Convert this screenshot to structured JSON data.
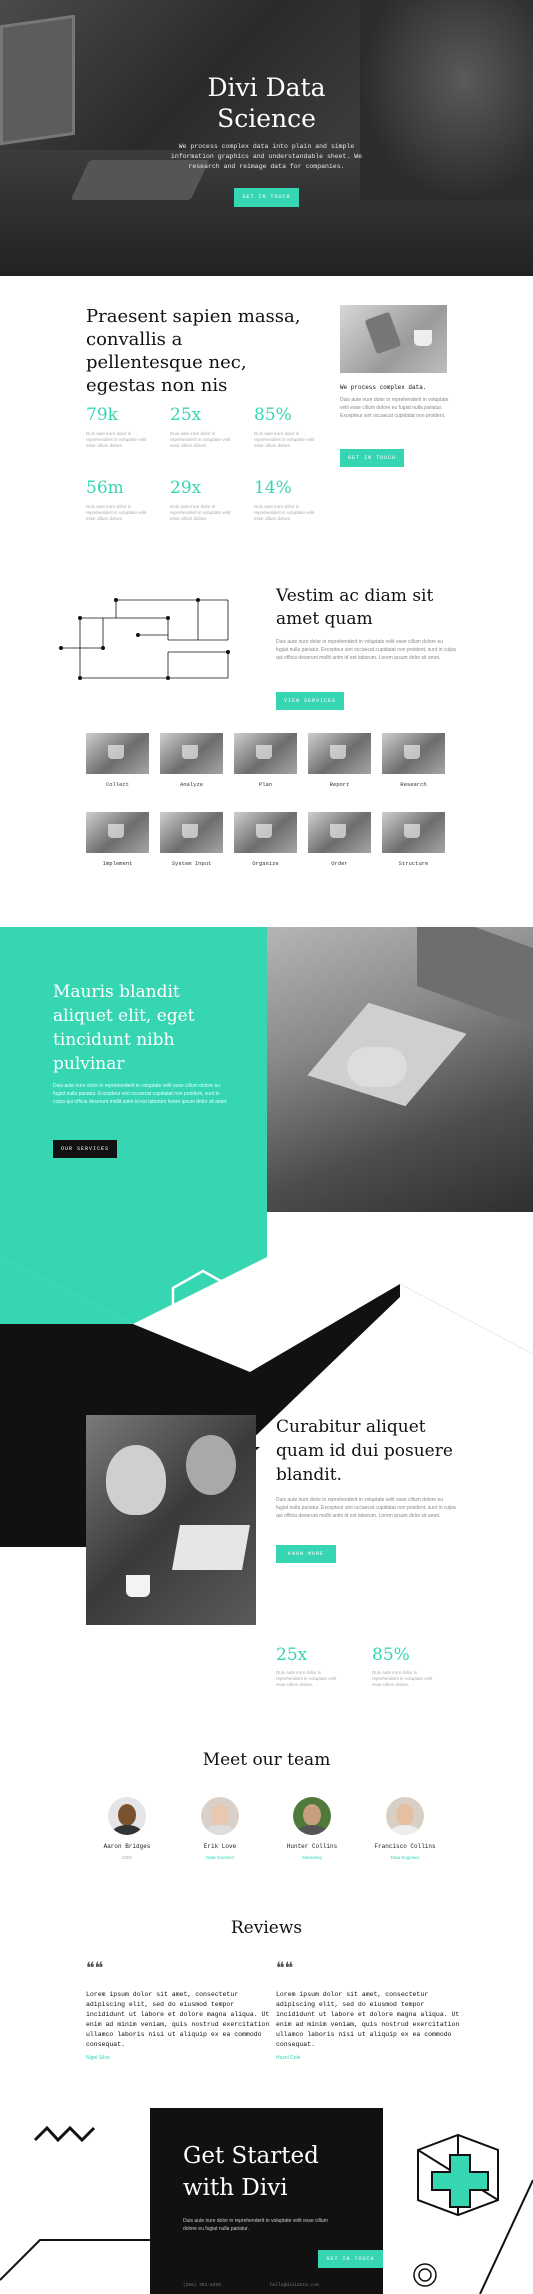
{
  "hero": {
    "title_line1": "Divi Data",
    "title_line2": "Science",
    "description": "We process complex data into plain and simple information graphics and understandable sheet. We research and reimage data for companies.",
    "button": "GET IN TOUCH"
  },
  "intro": {
    "title": "Praesent sapien massa, convallis a pellentesque nec, egestas non nis",
    "stats": [
      {
        "value": "79k",
        "text": "Duis aute irure dolor in reprehenderit in voluptate velit esse cillum dolore."
      },
      {
        "value": "25x",
        "text": "Duis aute irure dolor in reprehenderit in voluptate velit esse cillum dolore."
      },
      {
        "value": "85%",
        "text": "Duis aute irure dolor in reprehenderit in voluptate velit esse cillum dolore."
      },
      {
        "value": "56m",
        "text": "Duis aute irure dolor in reprehenderit in voluptate velit esse cillum dolore."
      },
      {
        "value": "29x",
        "text": "Duis aute irure dolor in reprehenderit in voluptate velit esse cillum dolore."
      },
      {
        "value": "14%",
        "text": "Duis aute irure dolor in reprehenderit in voluptate velit esse cillum dolore."
      }
    ],
    "subtitle": "We process complex data.",
    "body": "Duis aute irure dolor in reprehenderit in voluptate velit esse cillum dolore eu fugiat nulla pariatur. Excepteur sint occaecat cupidatat non proident.",
    "button": "GET IN TOUCH"
  },
  "process": {
    "title": "Vestim ac diam sit amet quam",
    "body": "Duis aute irure dolor in reprehenderit in voluptate velit esse cillum dolore eu fugiat nulla pariatur. Excepteur sint occaecat cupidatat non proident, sunt in culpa qui officia deserunt mollit anim id est laborum. Lorem ipsum dolor sit amet.",
    "button": "VIEW SERVICES",
    "steps_row1": [
      "Collect",
      "Analyze",
      "Plan",
      "Report",
      "Research"
    ],
    "steps_row2": [
      "Implement",
      "System Input",
      "Organize",
      "Order",
      "Structure"
    ]
  },
  "teal": {
    "title": "Mauris blandit aliquet elit, eget tincidunt nibh pulvinar",
    "body": "Duis aute irure dolor in reprehenderit in voluptate velit esse cillum dolore eu fugiat nulla pariatur. Excepteur sint occaecat cupidatat non proident, sunt in culpa qui officia deserunt mollit anim id est laborum lorem ipsum dolor sit amet.",
    "button": "OUR SERVICES"
  },
  "curabitur": {
    "title": "Curabitur aliquet quam id dui posuere blandit.",
    "body": "Duis aute irure dolor in reprehenderit in voluptate velit esse cillum dolore eu fugiat nulla pariatur. Excepteur sint occaecat cupidatat non proident, sunt in culpa qui officia deserunt mollit anim id est laborum. Lorem ipsum dolor sit amet.",
    "button": "KNOW MORE",
    "stats": [
      {
        "value": "25x",
        "text": "Duis aute irure dolor in reprehenderit in voluptate velit esse cillum dolore."
      },
      {
        "value": "85%",
        "text": "Duis aute irure dolor in reprehenderit in voluptate velit esse cillum dolore."
      }
    ]
  },
  "team": {
    "title": "Meet our team",
    "members": [
      {
        "name": "Aaron Bridges",
        "role": "CEO"
      },
      {
        "name": "Erik Love",
        "role": "Data Scientist"
      },
      {
        "name": "Hunter Collins",
        "role": "Marketing"
      },
      {
        "name": "Francisco Collins",
        "role": "Data Engineer"
      }
    ]
  },
  "reviews": {
    "title": "Reviews",
    "items": [
      {
        "text": "Lorem ipsum dolor sit amet, consectetur adipiscing elit, sed do eiusmod tempor incididunt ut labore et dolore magna aliqua. Ut enim ad minim veniam, quis nostrud exercitation ullamco laboris nisi ut aliquip ex ea commodo consequat.",
        "name": "Nigel Silva"
      },
      {
        "text": "Lorem ipsum dolor sit amet, consectetur adipiscing elit, sed do eiusmod tempor incididunt ut labore et dolore magna aliqua. Ut enim ad minim veniam, quis nostrud exercitation ullamco laboris nisi ut aliquip ex ea commodo consequat.",
        "name": "Hazel Cole"
      }
    ]
  },
  "cta": {
    "title_line1": "Get Started",
    "title_line2": "with Divi",
    "body": "Duis aute irure dolor in reprehenderit in voluptate velit esse cillum dolore eu fugiat nulla pariatur.",
    "button": "GET IN TOUCH",
    "footer_left": "(255) 352-6258",
    "footer_right": "hello@dividata.com"
  },
  "colors": {
    "accent": "#36d6b3",
    "dark": "#111111"
  }
}
